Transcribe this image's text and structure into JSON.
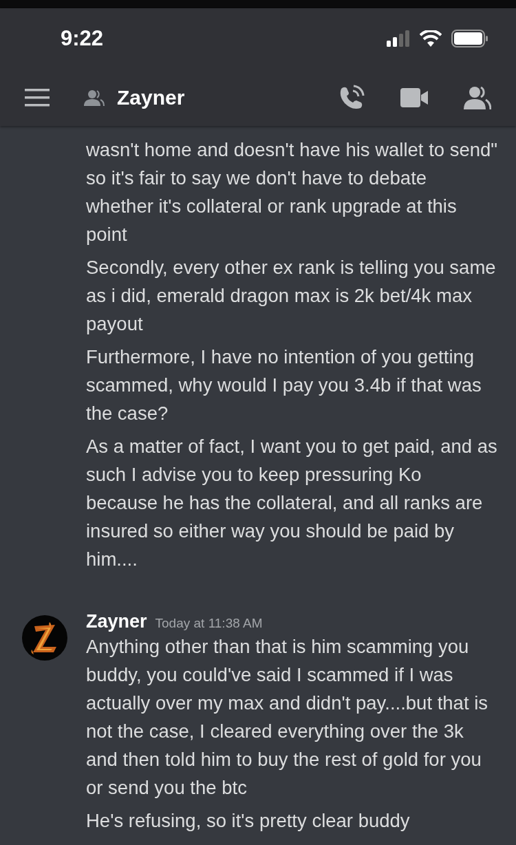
{
  "status_bar": {
    "time": "9:22"
  },
  "header": {
    "title": "Zayner"
  },
  "message_groups": [
    {
      "continuation": true,
      "messages": [
        "wasn't home and doesn't have his wallet to send\" so it's fair to say we don't have to debate whether it's collateral or rank upgrade at this point",
        "Secondly, every other ex rank is telling you same as i did, emerald dragon max is 2k bet/4k max payout",
        "Furthermore, I have no intention of you getting scammed, why would I pay you 3.4b if that was the case?",
        "As a matter of fact, I want you to get paid, and as such I advise you to keep pressuring Ko because he has the collateral, and all ranks are insured so either way you should be paid by him...."
      ]
    },
    {
      "continuation": false,
      "author": "Zayner",
      "timestamp": "Today at 11:38 AM",
      "messages": [
        "Anything other than that is him scamming you buddy, you could've said I scammed if I was actually over my max and didn't pay....but that is not the case, I cleared everything over the 3k and then told him to buy the rest of gold for you or send you the btc",
        "He's refusing, so it's pretty clear buddy"
      ]
    }
  ]
}
